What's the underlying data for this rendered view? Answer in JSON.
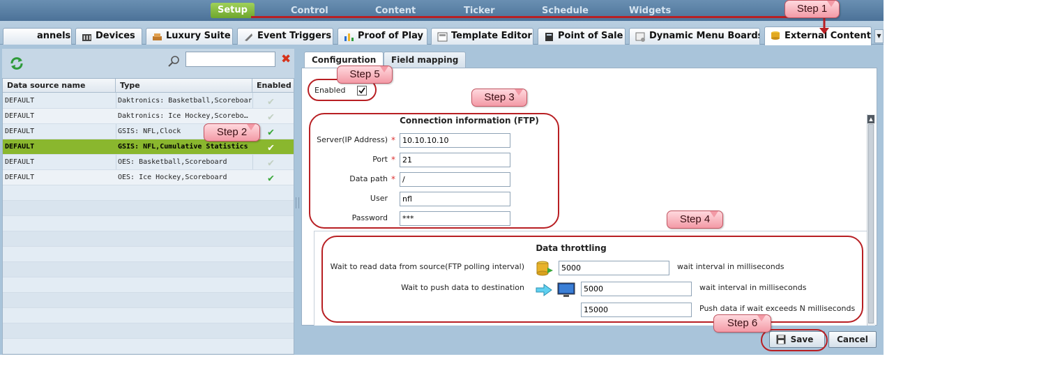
{
  "top_nav": {
    "items": [
      "Setup",
      "Control",
      "Content",
      "Ticker",
      "Schedule",
      "Widgets"
    ],
    "active": "Setup"
  },
  "tabs": {
    "items": [
      "annels",
      "Devices",
      "Luxury Suite",
      "Event Triggers",
      "Proof of Play",
      "Template Editor",
      "Point of Sale",
      "Dynamic Menu Boards",
      "External Content"
    ],
    "active": "External Content",
    "scroll_glyph": "▼"
  },
  "left": {
    "search_placeholder": "",
    "clear_glyph": "✖",
    "columns": [
      "Data source name",
      "Type",
      "Enabled"
    ],
    "rows": [
      {
        "name": "DEFAULT",
        "type": "Daktronics: Basketball,Scoreboard",
        "enabled": false
      },
      {
        "name": "DEFAULT",
        "type": "Daktronics: Ice Hockey,Scorebo…",
        "enabled": false
      },
      {
        "name": "DEFAULT",
        "type": "GSIS: NFL,Clock",
        "enabled": true
      },
      {
        "name": "DEFAULT",
        "type": "GSIS: NFL,Cumulative Statistics",
        "enabled": true,
        "selected": true
      },
      {
        "name": "DEFAULT",
        "type": "OES: Basketball,Scoreboard",
        "enabled": false
      },
      {
        "name": "DEFAULT",
        "type": "OES: Ice Hockey,Scoreboard",
        "enabled": true
      }
    ],
    "check_glyph": "✔"
  },
  "right": {
    "tabs": [
      "Configuration",
      "Field mapping"
    ],
    "active_tab": "Configuration",
    "enabled_label": "Enabled",
    "enabled_checked": true,
    "connection": {
      "title": "Connection information (FTP)",
      "fields": [
        {
          "label": "Server(IP Address)",
          "value": "10.10.10.10",
          "required": true
        },
        {
          "label": "Port",
          "value": "21",
          "required": true
        },
        {
          "label": "Data path",
          "value": "/",
          "required": true
        },
        {
          "label": "User",
          "value": "nfl",
          "required": false
        },
        {
          "label": "Password",
          "value": "***",
          "required": false
        }
      ],
      "required_mark": "*"
    },
    "throttling": {
      "title": "Data throttling",
      "read_label": "Wait to read data from source(FTP polling interval)",
      "read_value": "5000",
      "read_suffix": "wait interval in milliseconds",
      "push_label": "Wait to push data to destination",
      "push_value": "5000",
      "push_suffix": "wait interval in milliseconds",
      "exceed_value": "15000",
      "exceed_suffix": "Push data if wait exceeds N milliseconds"
    }
  },
  "buttons": {
    "save": "Save",
    "cancel": "Cancel"
  },
  "steps": [
    "Step 1",
    "Step 2",
    "Step 3",
    "Step 4",
    "Step 5",
    "Step 6"
  ],
  "colors": {
    "accent_green": "#8ab72e",
    "callout_red": "#b81f23",
    "step_pink": "#f39aa6"
  }
}
